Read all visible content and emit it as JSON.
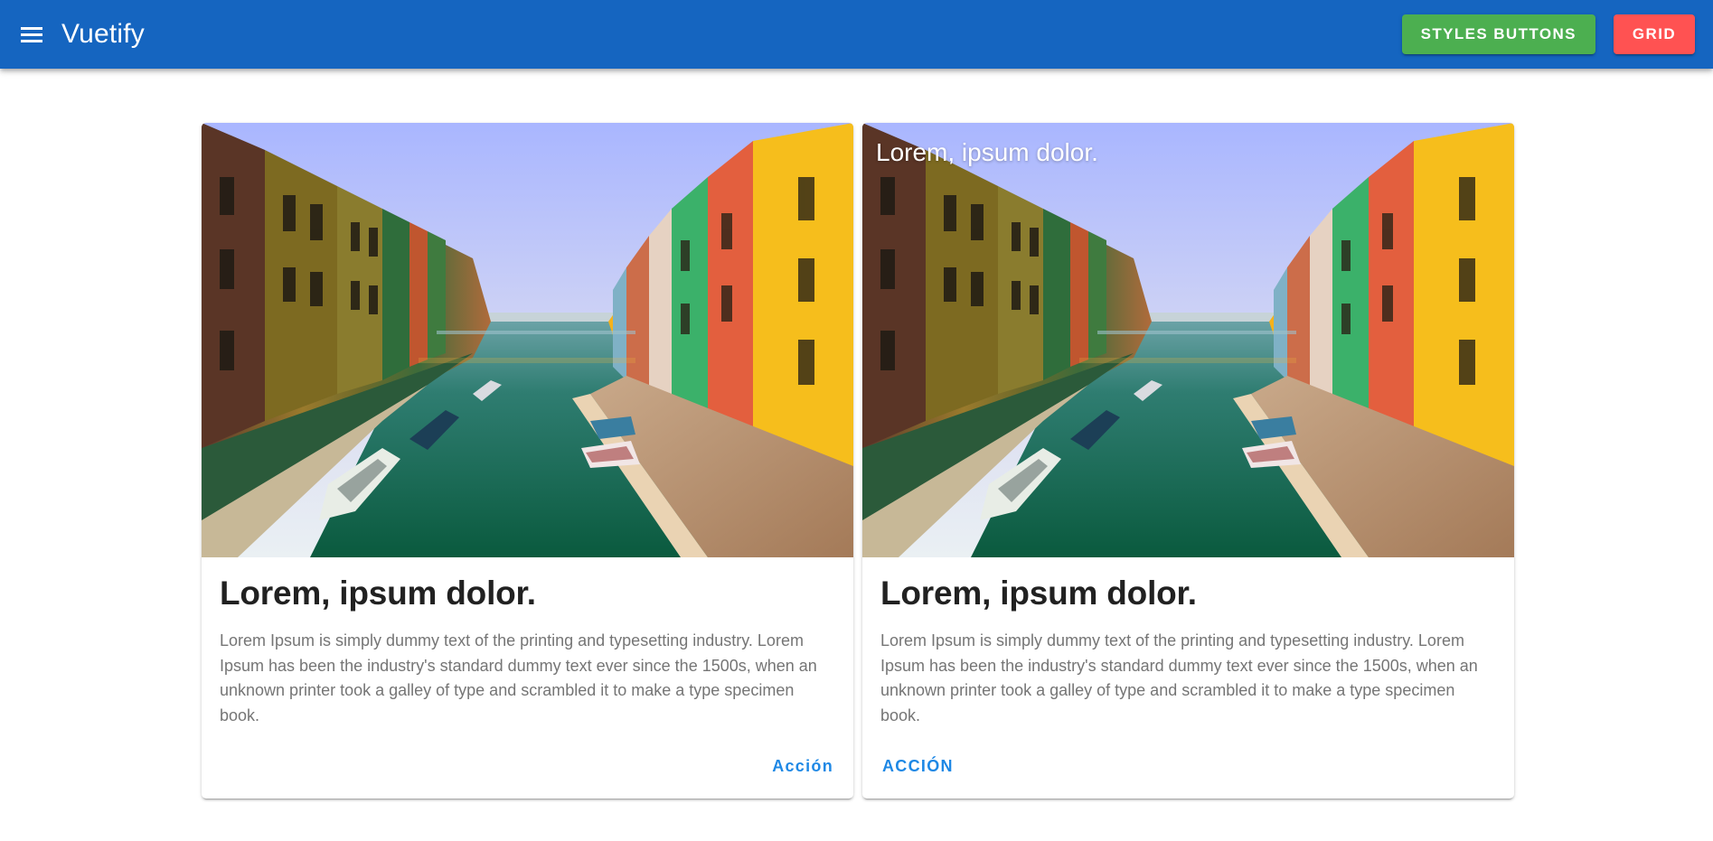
{
  "app_bar": {
    "menu_icon": "menu-icon",
    "title": "Vuetify",
    "buttons": {
      "styles_buttons": "STYLES BUTTONS",
      "grid": "GRID"
    },
    "colors": {
      "background": "#1565c0",
      "styles_buttons_bg": "#4caf50",
      "grid_bg": "#ff5252"
    }
  },
  "cards": [
    {
      "image_alt": "canal-with-colorful-houses",
      "overlay_title": "",
      "title": "Lorem, ipsum dolor.",
      "text": "Lorem Ipsum is simply dummy text of the printing and typesetting industry. Lorem Ipsum has been the industry's standard dummy text ever since the 1500s, when an unknown printer took a galley of type and scrambled it to make a type specimen book.",
      "action_label": "Acción"
    },
    {
      "image_alt": "canal-with-colorful-houses",
      "overlay_title": "Lorem, ipsum dolor.",
      "title": "Lorem, ipsum dolor.",
      "text": "Lorem Ipsum is simply dummy text of the printing and typesetting industry. Lorem Ipsum has been the industry's standard dummy text ever since the 1500s, when an unknown printer took a galley of type and scrambled it to make a type specimen book.",
      "action_label": "ACCIÓN"
    }
  ],
  "colors": {
    "action_text": "#1e88e5",
    "title_text": "#212121",
    "body_text": "#757575"
  }
}
